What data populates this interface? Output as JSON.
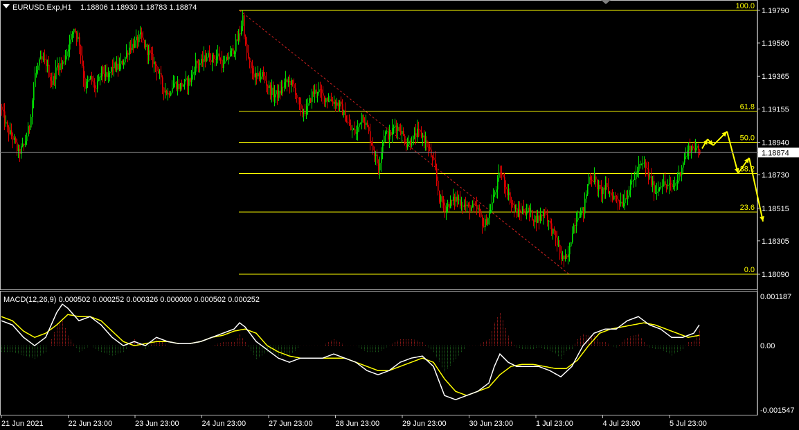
{
  "header": {
    "symbol": "EURUSD.Exp,H1",
    "ohlc": "1.18806 1.18930 1.18783 1.18874"
  },
  "macd": {
    "label": "MACD(12,26,9) 0.000502 0.000252 0.000326 0.000000 0.000502 0.000252"
  },
  "colors": {
    "background": "#000000",
    "bull": "#00e000",
    "bear": "#e00000",
    "fib": "#ffff00",
    "macd_line": "#ffffff",
    "signal_line": "#ffff00",
    "forecast_arrow": "#ffff00",
    "axis_text": "#ffffff",
    "price_tag_bg": "#ffffff",
    "frame": "#c0c0c0"
  },
  "chart_data": {
    "type": "candlestick",
    "symbol": "EURUSD",
    "timeframe": "H1",
    "grid": false,
    "price_axis": {
      "min": 1.1805,
      "max": 1.1983,
      "ticks": [
        "1.19790",
        "1.19580",
        "1.19365",
        "1.19155",
        "1.18940",
        "1.18730",
        "1.18515",
        "1.18305",
        "1.18090"
      ],
      "current_price": "1.18874"
    },
    "time_axis": {
      "labels": [
        "21 Jun 2021",
        "22 Jun 23:00",
        "23 Jun 23:00",
        "24 Jun 23:00",
        "27 Jun 23:00",
        "28 Jun 23:00",
        "29 Jun 23:00",
        "30 Jun 23:00",
        "1 Jul 23:00",
        "4 Jul 23:00",
        "5 Jul 23:00"
      ]
    },
    "close_anchors": [
      [
        0,
        1.1914
      ],
      [
        4,
        1.1902
      ],
      [
        8,
        1.1897
      ],
      [
        12,
        1.1887
      ],
      [
        16,
        1.1892
      ],
      [
        20,
        1.1905
      ],
      [
        24,
        1.1938
      ],
      [
        28,
        1.1947
      ],
      [
        32,
        1.1945
      ],
      [
        36,
        1.1932
      ],
      [
        40,
        1.1943
      ],
      [
        44,
        1.1945
      ],
      [
        48,
        1.1956
      ],
      [
        52,
        1.1968
      ],
      [
        56,
        1.1958
      ],
      [
        60,
        1.193
      ],
      [
        64,
        1.1935
      ],
      [
        68,
        1.1928
      ],
      [
        72,
        1.194
      ],
      [
        76,
        1.1935
      ],
      [
        80,
        1.1943
      ],
      [
        84,
        1.1942
      ],
      [
        88,
        1.1947
      ],
      [
        92,
        1.1955
      ],
      [
        96,
        1.1958
      ],
      [
        100,
        1.1962
      ],
      [
        104,
        1.1955
      ],
      [
        108,
        1.1948
      ],
      [
        112,
        1.1942
      ],
      [
        116,
        1.193
      ],
      [
        120,
        1.1925
      ],
      [
        124,
        1.1932
      ],
      [
        128,
        1.193
      ],
      [
        132,
        1.1932
      ],
      [
        136,
        1.1934
      ],
      [
        140,
        1.1945
      ],
      [
        144,
        1.1945
      ],
      [
        148,
        1.195
      ],
      [
        152,
        1.1948
      ],
      [
        156,
        1.195
      ],
      [
        160,
        1.1943
      ],
      [
        164,
        1.195
      ],
      [
        168,
        1.1955
      ],
      [
        172,
        1.1965
      ],
      [
        174,
        1.1975
      ],
      [
        176,
        1.1955
      ],
      [
        180,
        1.194
      ],
      [
        184,
        1.1935
      ],
      [
        188,
        1.1938
      ],
      [
        192,
        1.193
      ],
      [
        196,
        1.1925
      ],
      [
        200,
        1.1925
      ],
      [
        204,
        1.1932
      ],
      [
        208,
        1.1933
      ],
      [
        212,
        1.1927
      ],
      [
        216,
        1.1913
      ],
      [
        220,
        1.1915
      ],
      [
        224,
        1.1925
      ],
      [
        228,
        1.1928
      ],
      [
        232,
        1.1923
      ],
      [
        236,
        1.1922
      ],
      [
        240,
        1.192
      ],
      [
        244,
        1.1918
      ],
      [
        248,
        1.191
      ],
      [
        252,
        1.1902
      ],
      [
        256,
        1.19
      ],
      [
        260,
        1.1912
      ],
      [
        264,
        1.1903
      ],
      [
        268,
        1.189
      ],
      [
        272,
        1.1878
      ],
      [
        276,
        1.19
      ],
      [
        280,
        1.1898
      ],
      [
        284,
        1.1905
      ],
      [
        288,
        1.1902
      ],
      [
        292,
        1.1893
      ],
      [
        296,
        1.1895
      ],
      [
        300,
        1.19
      ],
      [
        304,
        1.1898
      ],
      [
        308,
        1.189
      ],
      [
        312,
        1.188
      ],
      [
        316,
        1.1858
      ],
      [
        320,
        1.1852
      ],
      [
        324,
        1.1855
      ],
      [
        328,
        1.1858
      ],
      [
        332,
        1.1855
      ],
      [
        336,
        1.1852
      ],
      [
        340,
        1.1852
      ],
      [
        344,
        1.185
      ],
      [
        348,
        1.184
      ],
      [
        352,
        1.1848
      ],
      [
        356,
        1.1862
      ],
      [
        360,
        1.1875
      ],
      [
        364,
        1.1865
      ],
      [
        368,
        1.1855
      ],
      [
        372,
        1.1848
      ],
      [
        376,
        1.185
      ],
      [
        380,
        1.185
      ],
      [
        384,
        1.1845
      ],
      [
        388,
        1.1845
      ],
      [
        392,
        1.185
      ],
      [
        396,
        1.184
      ],
      [
        400,
        1.1832
      ],
      [
        404,
        1.182
      ],
      [
        408,
        1.1818
      ],
      [
        410,
        1.1825
      ],
      [
        412,
        1.1838
      ],
      [
        416,
        1.1848
      ],
      [
        420,
        1.185
      ],
      [
        424,
        1.1872
      ],
      [
        428,
        1.187
      ],
      [
        432,
        1.1862
      ],
      [
        436,
        1.1865
      ],
      [
        440,
        1.186
      ],
      [
        444,
        1.1858
      ],
      [
        448,
        1.1855
      ],
      [
        452,
        1.1862
      ],
      [
        456,
        1.187
      ],
      [
        460,
        1.1878
      ],
      [
        464,
        1.188
      ],
      [
        468,
        1.187
      ],
      [
        472,
        1.1862
      ],
      [
        476,
        1.1868
      ],
      [
        480,
        1.1866
      ],
      [
        484,
        1.1865
      ],
      [
        488,
        1.187
      ],
      [
        492,
        1.1882
      ],
      [
        496,
        1.189
      ],
      [
        500,
        1.1891
      ],
      [
        504,
        1.1887
      ]
    ],
    "fibonacci": {
      "high": 1.1979,
      "low": 1.1809,
      "levels": [
        {
          "label": "100.0",
          "ratio": 1.0
        },
        {
          "label": "61.8",
          "ratio": 0.618
        },
        {
          "label": "50.0",
          "ratio": 0.5
        },
        {
          "label": "38.2",
          "ratio": 0.382
        },
        {
          "label": "23.6",
          "ratio": 0.236
        },
        {
          "label": "0.0",
          "ratio": 0.0
        }
      ]
    },
    "forecast_path": [
      [
        506,
        1.189
      ],
      [
        510,
        1.1896
      ],
      [
        514,
        1.1892
      ],
      [
        524,
        1.1901
      ],
      [
        532,
        1.1874
      ],
      [
        540,
        1.1884
      ],
      [
        550,
        1.1843
      ]
    ],
    "macd_panel": {
      "ticks": [
        "0.001187",
        "0.00",
        "-0.001547"
      ],
      "min": -0.001547,
      "max": 0.001187,
      "macd_anchors": [
        [
          0,
          0.0006
        ],
        [
          8,
          0.0005
        ],
        [
          16,
          0.0002
        ],
        [
          24,
          0.0
        ],
        [
          32,
          0.0002
        ],
        [
          40,
          0.0008
        ],
        [
          44,
          0.001
        ],
        [
          48,
          0.0009
        ],
        [
          56,
          0.0006
        ],
        [
          64,
          0.0007
        ],
        [
          72,
          0.0005
        ],
        [
          80,
          0.0002
        ],
        [
          88,
          0.0
        ],
        [
          96,
          0.0001
        ],
        [
          104,
          0.0
        ],
        [
          112,
          0.0002
        ],
        [
          120,
          0.0001
        ],
        [
          128,
          5e-05
        ],
        [
          136,
          5e-05
        ],
        [
          144,
          0.0001
        ],
        [
          152,
          0.0002
        ],
        [
          160,
          0.0003
        ],
        [
          168,
          0.0004
        ],
        [
          172,
          0.00055
        ],
        [
          176,
          0.00045
        ],
        [
          184,
          0.0001
        ],
        [
          192,
          -0.0001
        ],
        [
          200,
          -0.0003
        ],
        [
          208,
          -0.0004
        ],
        [
          216,
          -0.0003
        ],
        [
          224,
          -0.0003
        ],
        [
          232,
          -0.0003
        ],
        [
          240,
          -0.0002
        ],
        [
          248,
          -0.0003
        ],
        [
          256,
          -0.0004
        ],
        [
          264,
          -0.0006
        ],
        [
          272,
          -0.0007
        ],
        [
          280,
          -0.0006
        ],
        [
          288,
          -0.0004
        ],
        [
          296,
          -0.0003
        ],
        [
          304,
          -0.00025
        ],
        [
          312,
          -0.0005
        ],
        [
          320,
          -0.0012
        ],
        [
          328,
          -0.0013
        ],
        [
          336,
          -0.0012
        ],
        [
          344,
          -0.0011
        ],
        [
          352,
          -0.0009
        ],
        [
          356,
          -0.0005
        ],
        [
          360,
          -0.0002
        ],
        [
          366,
          -0.0004
        ],
        [
          372,
          -0.0005
        ],
        [
          380,
          -0.0005
        ],
        [
          388,
          -0.0005
        ],
        [
          396,
          -0.0006
        ],
        [
          404,
          -0.00075
        ],
        [
          412,
          -0.0005
        ],
        [
          420,
          0.0
        ],
        [
          428,
          0.0003
        ],
        [
          436,
          0.0004
        ],
        [
          444,
          0.0004
        ],
        [
          452,
          0.0006
        ],
        [
          460,
          0.0007
        ],
        [
          468,
          0.0005
        ],
        [
          476,
          0.0004
        ],
        [
          484,
          0.0002
        ],
        [
          492,
          0.0002
        ],
        [
          500,
          0.0003
        ],
        [
          504,
          0.0005
        ]
      ],
      "signal_anchors": [
        [
          0,
          0.0007
        ],
        [
          8,
          0.0006
        ],
        [
          16,
          0.00035
        ],
        [
          24,
          0.0002
        ],
        [
          32,
          0.0003
        ],
        [
          40,
          0.0005
        ],
        [
          48,
          0.00075
        ],
        [
          56,
          0.0007
        ],
        [
          64,
          0.0007
        ],
        [
          72,
          0.0006
        ],
        [
          80,
          0.00035
        ],
        [
          88,
          0.0001
        ],
        [
          96,
          0.0
        ],
        [
          104,
          5e-05
        ],
        [
          112,
          0.0001
        ],
        [
          120,
          0.0001
        ],
        [
          128,
          5e-05
        ],
        [
          136,
          5e-05
        ],
        [
          144,
          0.0001
        ],
        [
          152,
          0.0002
        ],
        [
          160,
          0.00025
        ],
        [
          168,
          0.00035
        ],
        [
          176,
          0.0004
        ],
        [
          184,
          0.0003
        ],
        [
          192,
          0.0
        ],
        [
          200,
          -0.00015
        ],
        [
          208,
          -0.00025
        ],
        [
          216,
          -0.0003
        ],
        [
          224,
          -0.0003
        ],
        [
          232,
          -0.0003
        ],
        [
          240,
          -0.0003
        ],
        [
          248,
          -0.0003
        ],
        [
          256,
          -0.0004
        ],
        [
          264,
          -0.0005
        ],
        [
          272,
          -0.0006
        ],
        [
          280,
          -0.0006
        ],
        [
          288,
          -0.0005
        ],
        [
          296,
          -0.0004
        ],
        [
          304,
          -0.0003
        ],
        [
          312,
          -0.0004
        ],
        [
          320,
          -0.0008
        ],
        [
          328,
          -0.0011
        ],
        [
          336,
          -0.0012
        ],
        [
          344,
          -0.0011
        ],
        [
          352,
          -0.001
        ],
        [
          360,
          -0.0007
        ],
        [
          368,
          -0.0005
        ],
        [
          376,
          -0.00045
        ],
        [
          384,
          -0.00045
        ],
        [
          392,
          -0.0005
        ],
        [
          400,
          -0.00055
        ],
        [
          408,
          -0.00055
        ],
        [
          416,
          -0.00035
        ],
        [
          424,
          0.0
        ],
        [
          432,
          0.0003
        ],
        [
          440,
          0.0004
        ],
        [
          448,
          0.00045
        ],
        [
          456,
          0.0005
        ],
        [
          464,
          0.00055
        ],
        [
          472,
          0.0005
        ],
        [
          480,
          0.0004
        ],
        [
          488,
          0.0003
        ],
        [
          496,
          0.0002
        ],
        [
          504,
          0.00025
        ]
      ]
    }
  }
}
